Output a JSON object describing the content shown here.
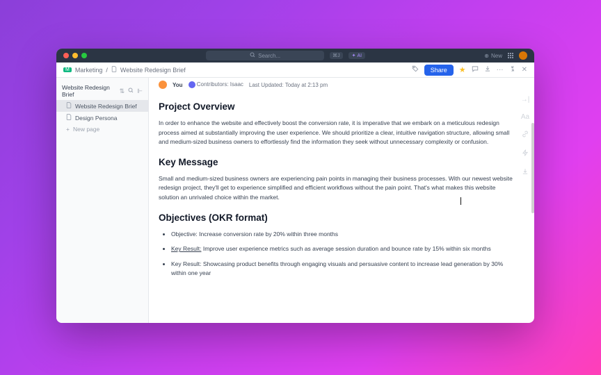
{
  "titlebar": {
    "search_placeholder": "Search...",
    "kbd": "⌘J",
    "ai": "AI",
    "new": "New"
  },
  "breadcrumb": {
    "workspace": "Marketing",
    "sep": "/",
    "page": "Website Redesign Brief"
  },
  "toolbar": {
    "share": "Share"
  },
  "sidebar": {
    "title": "Website Redesign Brief",
    "items": [
      {
        "label": "Website Redesign Brief",
        "active": true
      },
      {
        "label": "Design Persona",
        "active": false
      }
    ],
    "new_page": "New page"
  },
  "doc_header": {
    "you": "You",
    "contributors_label": "Contributors:",
    "contributors": "Isaac",
    "updated_label": "Last Updated:",
    "updated_val": "Today at 2:13 pm"
  },
  "doc": {
    "h_overview": "Project Overview",
    "p_overview": "In order to enhance the website and effectively boost the conversion rate, it is imperative that we embark on a meticulous redesign process aimed at substantially improving the user experience. We should prioritize a clear, intuitive navigation structure, allowing small and medium-sized business owners to effortlessly find the information they seek without unnecessary complexity or confusion.",
    "h_keymsg": "Key Message",
    "p_keymsg": "Small and medium-sized business owners are experiencing pain points in managing their business processes. With our newest website redesign project, they'll get to experience simplified and efficient workflows without the pain point. That's what makes this website solution an unrivaled choice within the market.",
    "h_obj": "Objectives (OKR format)",
    "li1": "Objective: Increase conversion rate by 20% within three months",
    "li2_pre": "Key Result:",
    "li2": " Improve user experience metrics such as average session duration and bounce rate by 15% within six months",
    "li3": "Key Result: Showcasing product benefits through engaging visuals and persuasive content to increase lead generation by 30% within one year"
  },
  "right_rail": {
    "aa": "Aa"
  }
}
